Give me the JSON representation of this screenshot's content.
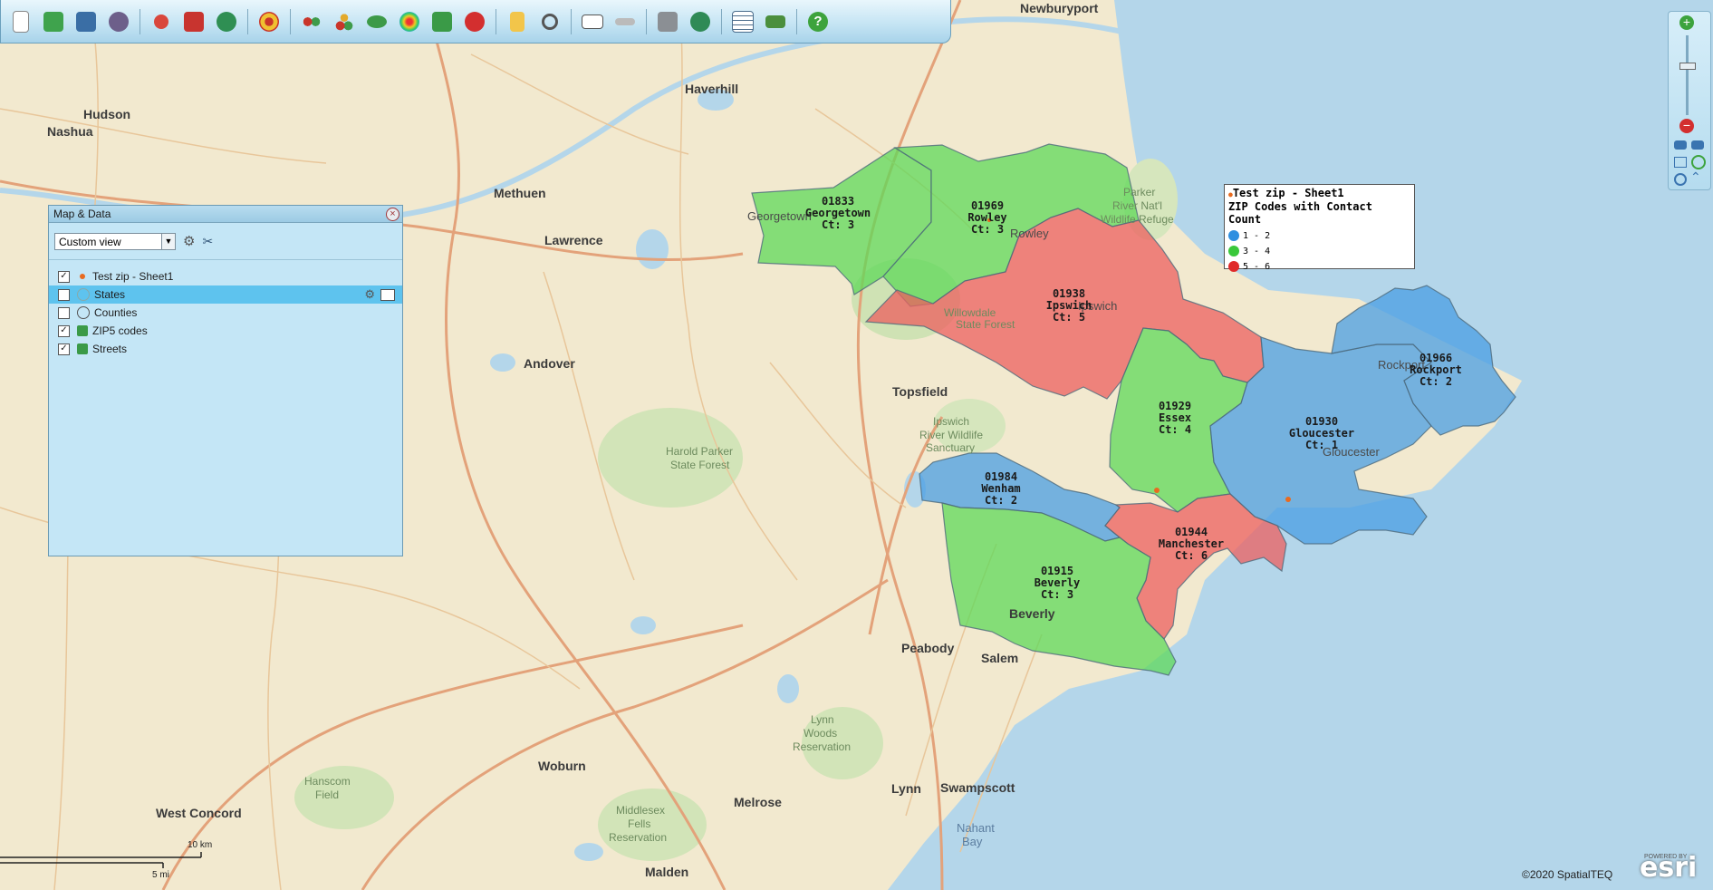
{
  "toolbar": {
    "icons": [
      "new-icon",
      "open-icon",
      "save-icon",
      "users-icon",
      "pushpin-add-icon",
      "puzzle-add-icon",
      "globe-icon",
      "radius-target-icon",
      "data-dots-icon",
      "cluster-icon",
      "layers-icon",
      "heatmap-icon",
      "territory-icon",
      "delete-icon",
      "document-icon",
      "search-icon",
      "label-icon",
      "ruler-icon",
      "cube-icon",
      "globe-map-icon",
      "grid-icon",
      "route-icon",
      "help-icon"
    ]
  },
  "panel": {
    "title": "Map & Data",
    "view_select": "Custom view",
    "layers": [
      {
        "label": "Test zip - Sheet1",
        "checked": true
      },
      {
        "label": "States",
        "checked": false
      },
      {
        "label": "Counties",
        "checked": false
      },
      {
        "label": "ZIP5 codes",
        "checked": true
      },
      {
        "label": "Streets",
        "checked": true
      }
    ]
  },
  "legend": {
    "title": "Test zip - Sheet1",
    "subtitle": "ZIP Codes with Contact Count",
    "items": [
      {
        "label": "1 - 2",
        "color": "#2e8fe0"
      },
      {
        "label": "3 - 4",
        "color": "#39c83a"
      },
      {
        "label": "5 - 6",
        "color": "#e02a2a"
      }
    ]
  },
  "zips": [
    {
      "zip": "01833",
      "name": "Georgetown",
      "count": "Ct: 3",
      "color": "#5fd85a"
    },
    {
      "zip": "01969",
      "name": "Rowley",
      "count": "Ct: 3",
      "color": "#5fd85a"
    },
    {
      "zip": "01938",
      "name": "Ipswich",
      "count": "Ct: 5",
      "color": "#ec5f5f"
    },
    {
      "zip": "01929",
      "name": "Essex",
      "count": "Ct: 4",
      "color": "#5fd85a"
    },
    {
      "zip": "01930",
      "name": "Gloucester",
      "count": "Ct: 1",
      "color": "#4a9de3"
    },
    {
      "zip": "01966",
      "name": "Rockport",
      "count": "Ct: 2",
      "color": "#4a9de3"
    },
    {
      "zip": "01984",
      "name": "Wenham",
      "count": "Ct: 2",
      "color": "#4a9de3"
    },
    {
      "zip": "01944",
      "name": "Manchester",
      "count": "Ct: 6",
      "color": "#ec5f5f"
    },
    {
      "zip": "01915",
      "name": "Beverly",
      "count": "Ct: 3",
      "color": "#5fd85a"
    }
  ],
  "places": {
    "newburyport": "Newburyport",
    "haverhill": "Haverhill",
    "hudson": "Hudson",
    "nashua": "Nashua",
    "methuen": "Methuen",
    "lawrence": "Lawrence",
    "georgetown": "Georgetown",
    "rowley": "Rowley",
    "ipswich": "Ipswich",
    "andover": "Andover",
    "topsfield": "Topsfield",
    "gloucester": "Gloucester",
    "rockport": "Rockport",
    "beverly": "Beverly",
    "peabody": "Peabody",
    "salem": "Salem",
    "woburn": "Woburn",
    "melrose": "Melrose",
    "lynn": "Lynn",
    "swampscott": "Swampscott",
    "west_concord": "West Concord",
    "malden": "Malden",
    "nahant_bay": "Nahant\nBay",
    "harold_parker": "Harold Parker\nState Forest",
    "willowdale": "Willowdale\nState Forest",
    "ipswich_river": "Ipswich\nRiver Wildlife\nSanctuary",
    "lynn_woods": "Lynn\nWoods\nReservation",
    "middlesex_fells": "Middlesex\nFells\nReservation",
    "hanscom": "Hanscom\nField",
    "parker_river": "Parker\nRiver Nat'l\nWildlife Refuge"
  },
  "scale": {
    "km": "10 km",
    "mi": "5 mi"
  },
  "copyright": "©2020 SpatialTEQ",
  "esri": {
    "powered": "POWERED BY",
    "logo": "esri"
  }
}
